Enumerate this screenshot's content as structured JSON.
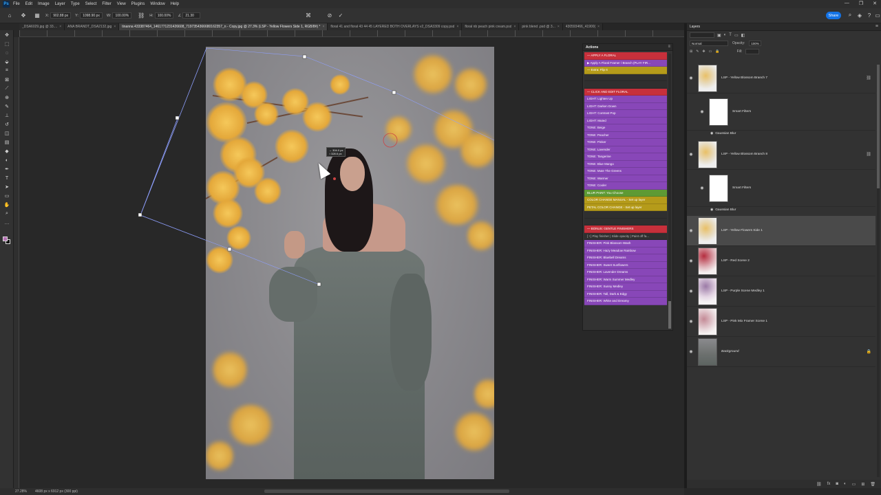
{
  "app": {
    "logo": "Ps"
  },
  "menu": [
    "File",
    "Edit",
    "Image",
    "Layer",
    "Type",
    "Select",
    "Filter",
    "View",
    "Plugins",
    "Window",
    "Help"
  ],
  "window_controls": [
    "—",
    "❐",
    "✕"
  ],
  "options_bar": {
    "x_label": "X:",
    "x_value": "902.88 px",
    "y_label": "Y:",
    "y_value": "1098.90 px",
    "w_label": "W:",
    "w_value": "100.00%",
    "h_label": "H:",
    "h_value": "100.00%",
    "angle_label": "∠",
    "angle_value": "21.30",
    "share_label": "Share"
  },
  "tabs": [
    {
      "label": "_DSA6029.jpg @ 33....",
      "active": false
    },
    {
      "label": "ANA BRANDT_DSA2132.jpg",
      "active": false
    },
    {
      "label": "tinanna 433387464_1461771231426608_7197354366680162357_n - Copy.jpg @ 27.3% (LSP - Yellow Flowers Side 1, RGB/8#) *",
      "active": true
    },
    {
      "label": "floral 41 and floral 43 44 45 LAYERED BOTH OVERLAYS v2_DSA3309 copy.psd",
      "active": false
    },
    {
      "label": "floral nb peach pink cream.psd",
      "active": false
    },
    {
      "label": "pink blend .psd @ 3...",
      "active": false
    },
    {
      "label": "430593466_41900(",
      "active": false
    }
  ],
  "transform_readout": {
    "line1": "↔ 304.0 px",
    "line2": "↕ 328.6 px"
  },
  "actions_panel": {
    "title": "Actions",
    "items": [
      {
        "label": "— APPLY A FLORAL",
        "style": "red"
      },
      {
        "label": "▶ Apply A Floral Framer / Branch (PLAY FIR...",
        "style": "purple"
      },
      {
        "label": "— Extra: Flip It",
        "style": "yellow"
      },
      {
        "label": "",
        "style": "sep"
      },
      {
        "label": "",
        "style": "gray"
      },
      {
        "label": "— CLICK AND EDIT FLORAL",
        "style": "red"
      },
      {
        "label": "LIGHT: Lighten Up",
        "style": "purple"
      },
      {
        "label": "LIGHT: Darken Down",
        "style": "purple"
      },
      {
        "label": "LIGHT: Contrast Pop",
        "style": "purple"
      },
      {
        "label": "LIGHT: Muted",
        "style": "purple"
      },
      {
        "label": "TONE: Beige",
        "style": "purple"
      },
      {
        "label": "TONE: Peacher",
        "style": "purple"
      },
      {
        "label": "TONE: Pinker",
        "style": "purple"
      },
      {
        "label": "TONE: Lavender",
        "style": "purple"
      },
      {
        "label": "TONE: Tangerine",
        "style": "purple"
      },
      {
        "label": "TONE: Blue Mango",
        "style": "purple"
      },
      {
        "label": "TONE: Mute The Greens",
        "style": "purple"
      },
      {
        "label": "TONE: Warmer",
        "style": "purple"
      },
      {
        "label": "TONE: Cooler",
        "style": "purple"
      },
      {
        "label": "BLUR PAINT: You Choose",
        "style": "green"
      },
      {
        "label": "COLOR CHANGE MANUAL - Set up layer",
        "style": "yellow"
      },
      {
        "label": "PETAL COLOR CHANGE - Set up layer",
        "style": "yellow"
      },
      {
        "label": "",
        "style": "sep"
      },
      {
        "label": "",
        "style": "gray"
      },
      {
        "label": "— BONUS: GENTLE FINISHERS",
        "style": "red"
      },
      {
        "label": "[ ! ] Play finisher | Slide opacity | Paint off fa...",
        "style": "gray"
      },
      {
        "label": "FINISHER: Pink Blossom Wash",
        "style": "purple"
      },
      {
        "label": "FINISHER: Hazy Meadow Rainbow",
        "style": "purple"
      },
      {
        "label": "FINISHER: Bluebell Dreams",
        "style": "purple"
      },
      {
        "label": "FINISHER: Sweet Sunflowers",
        "style": "purple"
      },
      {
        "label": "FINISHER: Lavender Dreams",
        "style": "purple"
      },
      {
        "label": "FINISHER: Warm Summer Medley",
        "style": "purple"
      },
      {
        "label": "FINISHER: Sunny Medley",
        "style": "purple"
      },
      {
        "label": "FINISHER: Tall, Dark & Edgy",
        "style": "purple"
      },
      {
        "label": "FINISHER: White and Dreamy",
        "style": "purple"
      }
    ]
  },
  "layers_panel": {
    "title": "Layers",
    "blend_mode": "Normal",
    "opacity_label": "Opacity:",
    "opacity_value": "100%",
    "fill_label": "Fill:",
    "layers": [
      {
        "name": "LSP - Yellow Blossom Branch 7",
        "kind": "floral-yellow",
        "selected": false
      },
      {
        "name": "Smart Filters",
        "kind": "smart-filter",
        "selected": false,
        "filter": "Gaussian Blur"
      },
      {
        "name": "LSP - Yellow Blossom Branch 8",
        "kind": "floral-yellow",
        "selected": false
      },
      {
        "name": "Smart Filters",
        "kind": "smart-filter",
        "selected": false,
        "filter": "Gaussian Blur"
      },
      {
        "name": "LSP - Yellow Flowers Side 1",
        "kind": "floral-yellow",
        "selected": true
      },
      {
        "name": "LSP - Red Scene 2",
        "kind": "floral-red",
        "selected": false
      },
      {
        "name": "LSP - Purple Scene Medley 1",
        "kind": "floral-purple",
        "selected": false
      },
      {
        "name": "LSP - Pink Mix Framer Scene 1",
        "kind": "floral-pink",
        "selected": false
      },
      {
        "name": "Background",
        "kind": "photo",
        "selected": false
      }
    ]
  },
  "status": {
    "zoom": "27.28%",
    "doc_size": "4608 px x 6912 px (300 ppi)"
  }
}
